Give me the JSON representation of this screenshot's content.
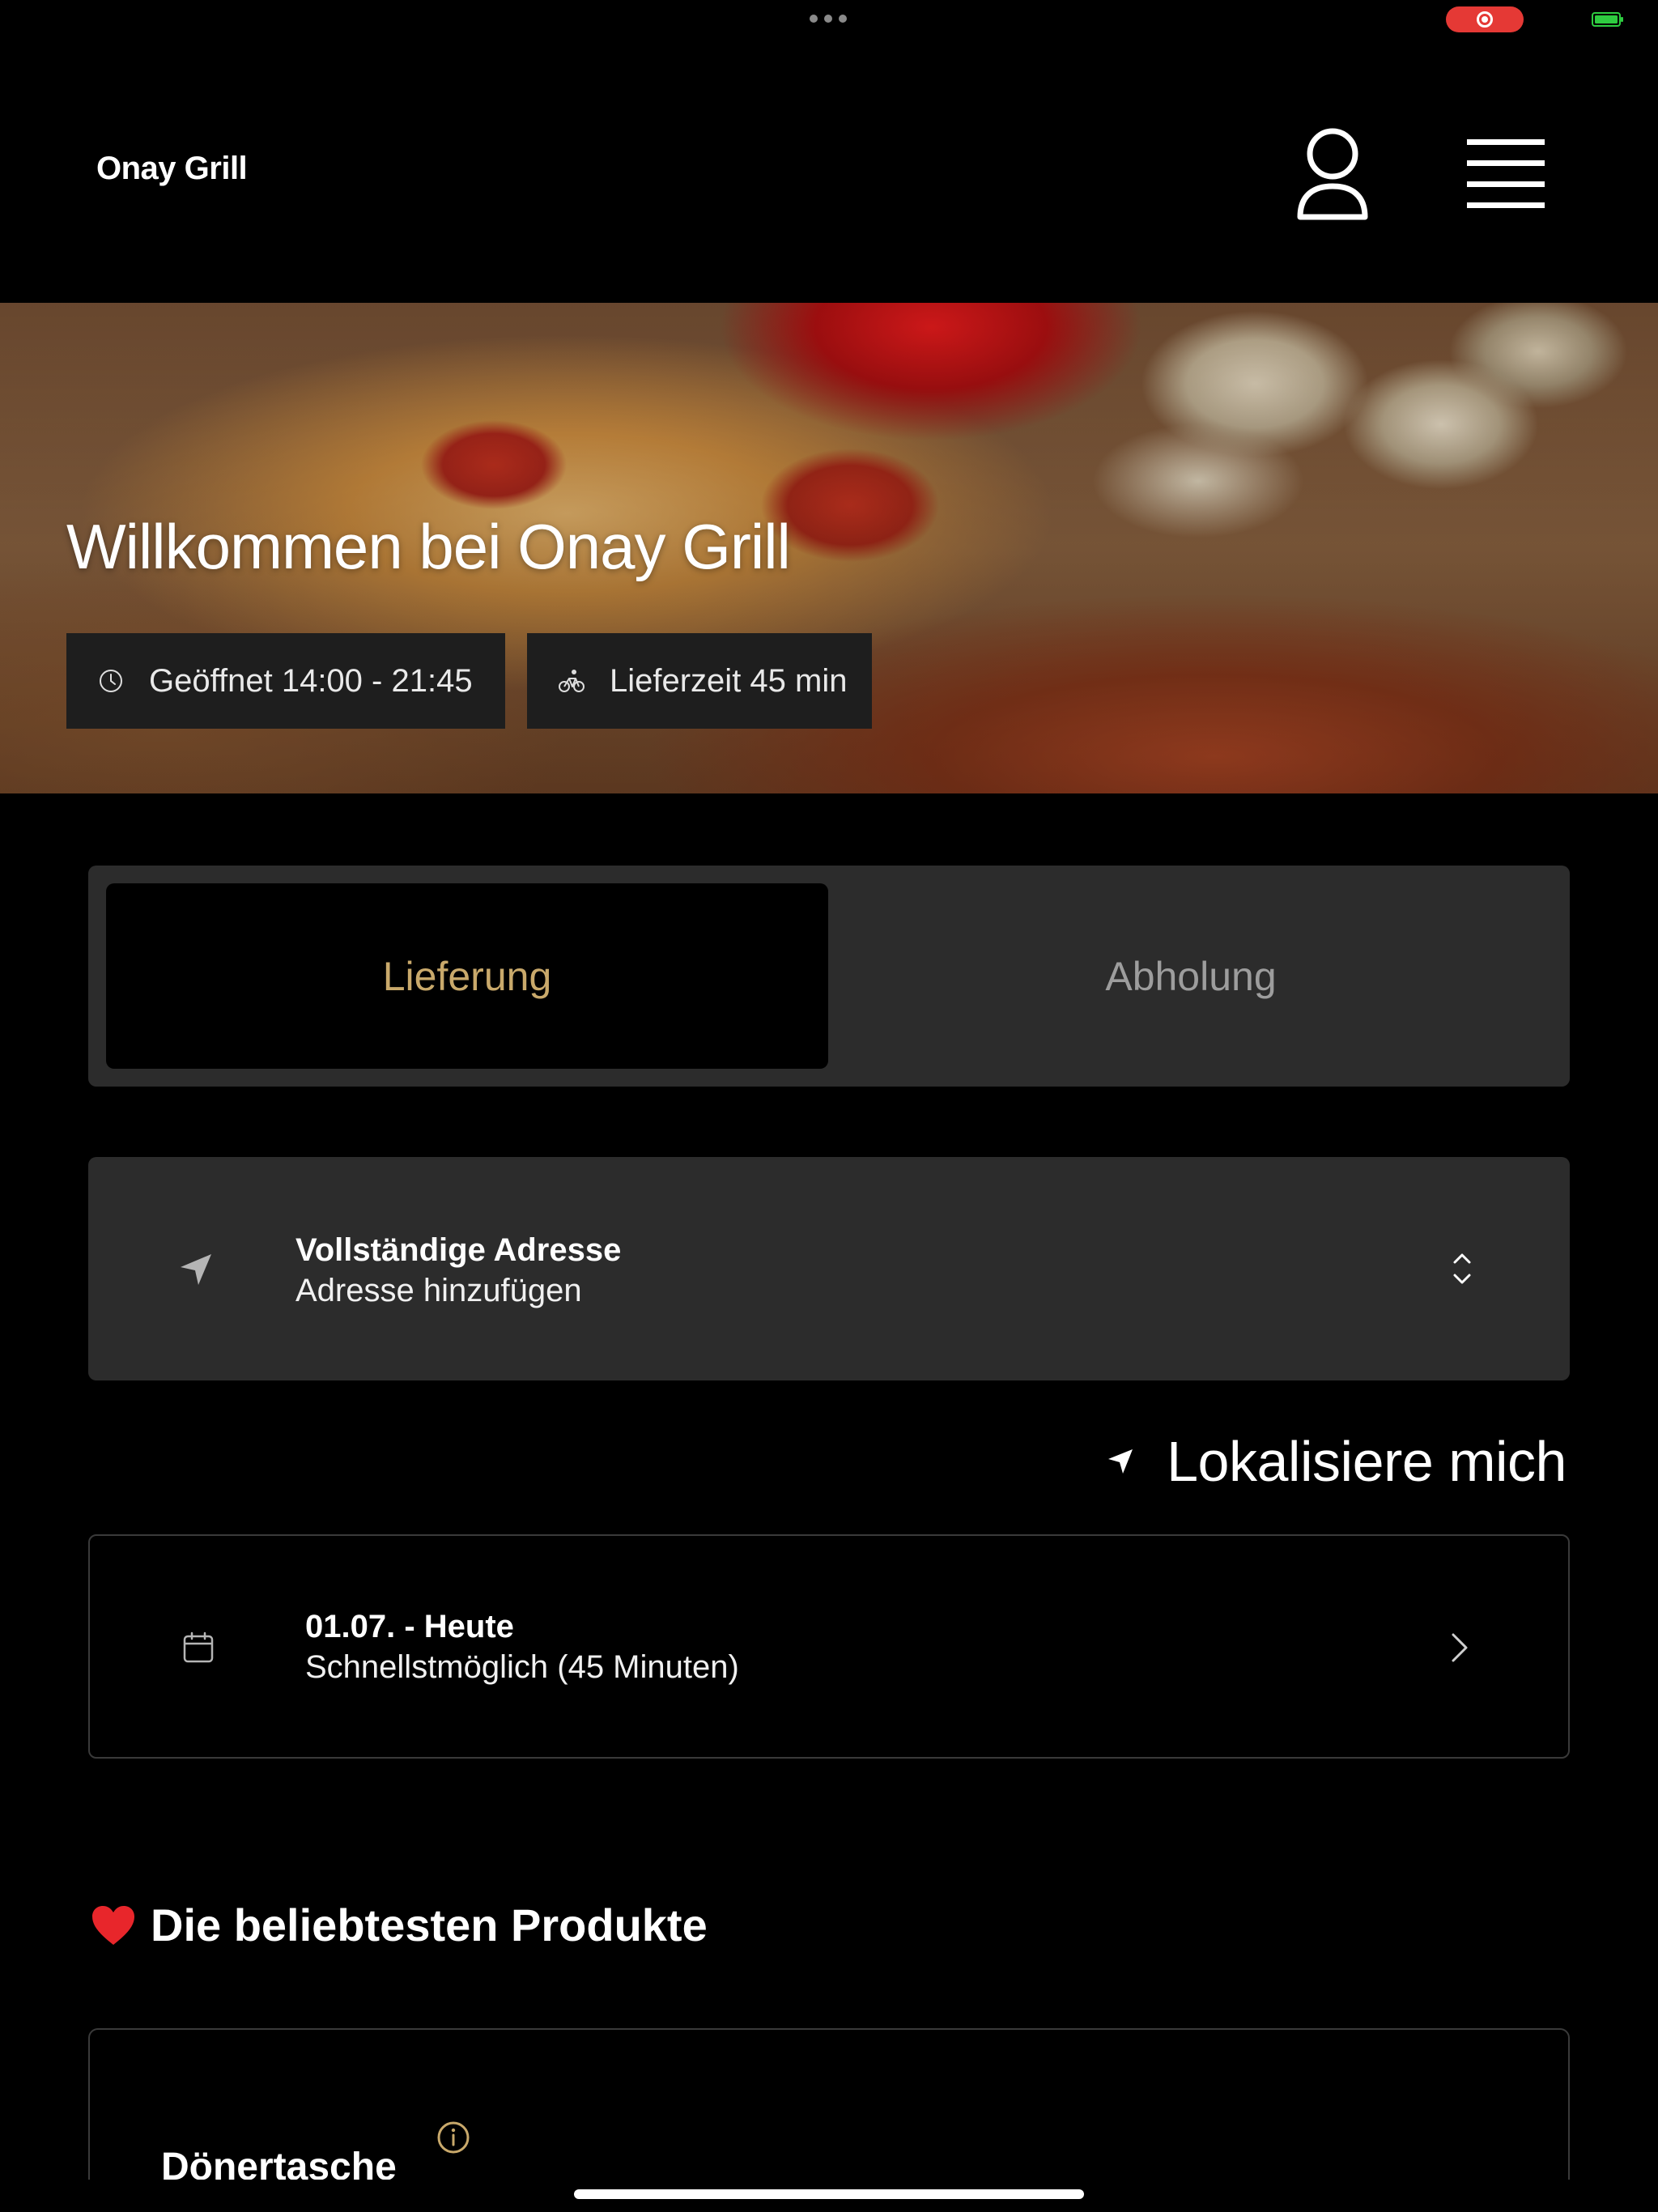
{
  "app": {
    "brand": "Onay Grill"
  },
  "header": {
    "profile_icon": "person-icon",
    "menu_icon": "hamburger-menu-icon"
  },
  "hero": {
    "title": "Willkommen bei Onay Grill",
    "chips": [
      {
        "icon": "clock-icon",
        "label": "Geöffnet 14:00 - 21:45"
      },
      {
        "icon": "bicycle-icon",
        "label": "Lieferzeit 45 min"
      }
    ]
  },
  "mode_switch": {
    "tabs": [
      {
        "label": "Lieferung",
        "active": true
      },
      {
        "label": "Abholung",
        "active": false
      }
    ],
    "active_color": "#c9a96b"
  },
  "address": {
    "icon": "location-arrow-icon",
    "title": "Vollständige Adresse",
    "subtitle": "Adresse hinzufügen",
    "action_icon": "chevron-up-down-icon"
  },
  "locate": {
    "icon": "location-arrow-icon",
    "label": "Lokalisiere mich"
  },
  "schedule": {
    "icon": "calendar-icon",
    "title": "01.07. - Heute",
    "subtitle": "Schnellstmöglich (45 Minuten)",
    "action_icon": "chevron-right-icon"
  },
  "popular": {
    "emoji": "❤️",
    "heading": "Die beliebtesten Produkte",
    "products": [
      {
        "name": "Dönertasche",
        "info_icon": "info-icon"
      }
    ]
  },
  "colors": {
    "background": "#000000",
    "card": "#2c2c2c",
    "accent": "#c9a96b",
    "recording": "#e53935"
  }
}
